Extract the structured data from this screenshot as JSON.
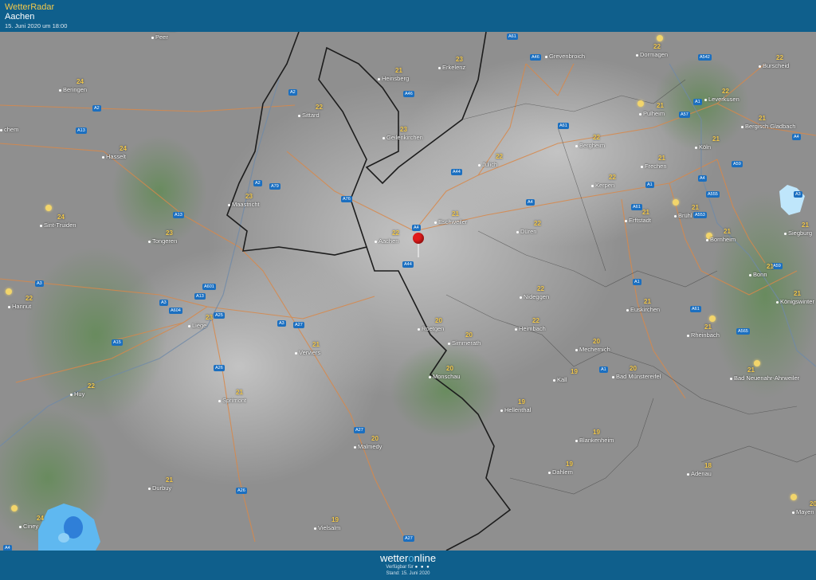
{
  "header": {
    "brand": "WetterRadar",
    "location": "Aachen",
    "timestamp": "15. Juni 2020 um 18:00"
  },
  "footer": {
    "logo_a": "wetter",
    "logo_o": "o",
    "logo_b": "nline",
    "available": "Verfügbar für",
    "stand": "Stand: 15. Juni 2020"
  },
  "colors": {
    "header_bg": "#0f5f8c",
    "temp_label": "#f2c84b",
    "highway_shield": "#1b6fc0",
    "pin": "#e21b1b",
    "precip": "#4aa8f0"
  },
  "map": {
    "cities": [
      {
        "name": "Peer",
        "temp": "22"
      },
      {
        "name": "Beringen",
        "temp": "24"
      },
      {
        "name": "chem",
        "temp": ""
      },
      {
        "name": "Hasselt",
        "temp": "24"
      },
      {
        "name": "Sint-Truiden",
        "temp": "24"
      },
      {
        "name": "Tongeren",
        "temp": "23"
      },
      {
        "name": "Hannut",
        "temp": "22"
      },
      {
        "name": "Liège",
        "temp": "23"
      },
      {
        "name": "Huy",
        "temp": "22"
      },
      {
        "name": "Ciney",
        "temp": "24"
      },
      {
        "name": "Durbuy",
        "temp": "21"
      },
      {
        "name": "Sprimont",
        "temp": "21"
      },
      {
        "name": "Verviers",
        "temp": "21"
      },
      {
        "name": "Malmedy",
        "temp": "20"
      },
      {
        "name": "Vielsalm",
        "temp": "19"
      },
      {
        "name": "Sittard",
        "temp": "22"
      },
      {
        "name": "Maastricht",
        "temp": "23"
      },
      {
        "name": "Heinsberg",
        "temp": "21"
      },
      {
        "name": "Geilenkirchen",
        "temp": "23"
      },
      {
        "name": "Erkelenz",
        "temp": "23"
      },
      {
        "name": "Aachen",
        "temp": "22"
      },
      {
        "name": "Eschweiler",
        "temp": "21"
      },
      {
        "name": "Jülich",
        "temp": "22"
      },
      {
        "name": "Düren",
        "temp": "22"
      },
      {
        "name": "Roetgen",
        "temp": "20"
      },
      {
        "name": "Simmerath",
        "temp": "20"
      },
      {
        "name": "Monschau",
        "temp": "20"
      },
      {
        "name": "Nideggen",
        "temp": "22"
      },
      {
        "name": "Heimbach",
        "temp": "22"
      },
      {
        "name": "Hellenthal",
        "temp": "19"
      },
      {
        "name": "Kall",
        "temp": "19"
      },
      {
        "name": "Mechernich",
        "temp": "20"
      },
      {
        "name": "Blankenheim",
        "temp": "19"
      },
      {
        "name": "Dahlem",
        "temp": "19"
      },
      {
        "name": "Grevenbroich",
        "temp": ""
      },
      {
        "name": "Bergheim",
        "temp": "22"
      },
      {
        "name": "Kerpen",
        "temp": "22"
      },
      {
        "name": "Frechen",
        "temp": "21"
      },
      {
        "name": "Erftstadt",
        "temp": "21"
      },
      {
        "name": "Euskirchen",
        "temp": "21"
      },
      {
        "name": "Bad Münstereifel",
        "temp": "20"
      },
      {
        "name": "Dormagen",
        "temp": "22"
      },
      {
        "name": "Pulheim",
        "temp": "21"
      },
      {
        "name": "Köln",
        "temp": "21"
      },
      {
        "name": "Leverkusen",
        "temp": "22"
      },
      {
        "name": "Burscheid",
        "temp": "22"
      },
      {
        "name": "Bergisch Gladbach",
        "temp": "21"
      },
      {
        "name": "Brühl",
        "temp": "21"
      },
      {
        "name": "Bornheim",
        "temp": "21"
      },
      {
        "name": "Siegburg",
        "temp": "21"
      },
      {
        "name": "Bonn",
        "temp": "21"
      },
      {
        "name": "Königswinter",
        "temp": "21"
      },
      {
        "name": "Rheinbach",
        "temp": "21"
      },
      {
        "name": "Bad Neuenahr-Ahrweiler",
        "temp": "21"
      },
      {
        "name": "Adenau",
        "temp": "18"
      },
      {
        "name": "Mayen",
        "temp": "20"
      }
    ],
    "roads": [
      "A2",
      "A13",
      "A2",
      "A13",
      "A3",
      "A601",
      "A13",
      "A604",
      "A15",
      "A3",
      "A25",
      "A26",
      "A3",
      "A27",
      "A27",
      "A26",
      "A27",
      "A2",
      "A79",
      "A76",
      "A4",
      "A44",
      "A61",
      "A46",
      "A44",
      "A61",
      "A46",
      "A4",
      "A1",
      "A57",
      "A1",
      "A4",
      "A59",
      "A3",
      "A555",
      "A553",
      "A61",
      "A1",
      "A1",
      "A61",
      "A565",
      "A59",
      "A4",
      "A542",
      "A4"
    ],
    "marker": "Aachen"
  }
}
